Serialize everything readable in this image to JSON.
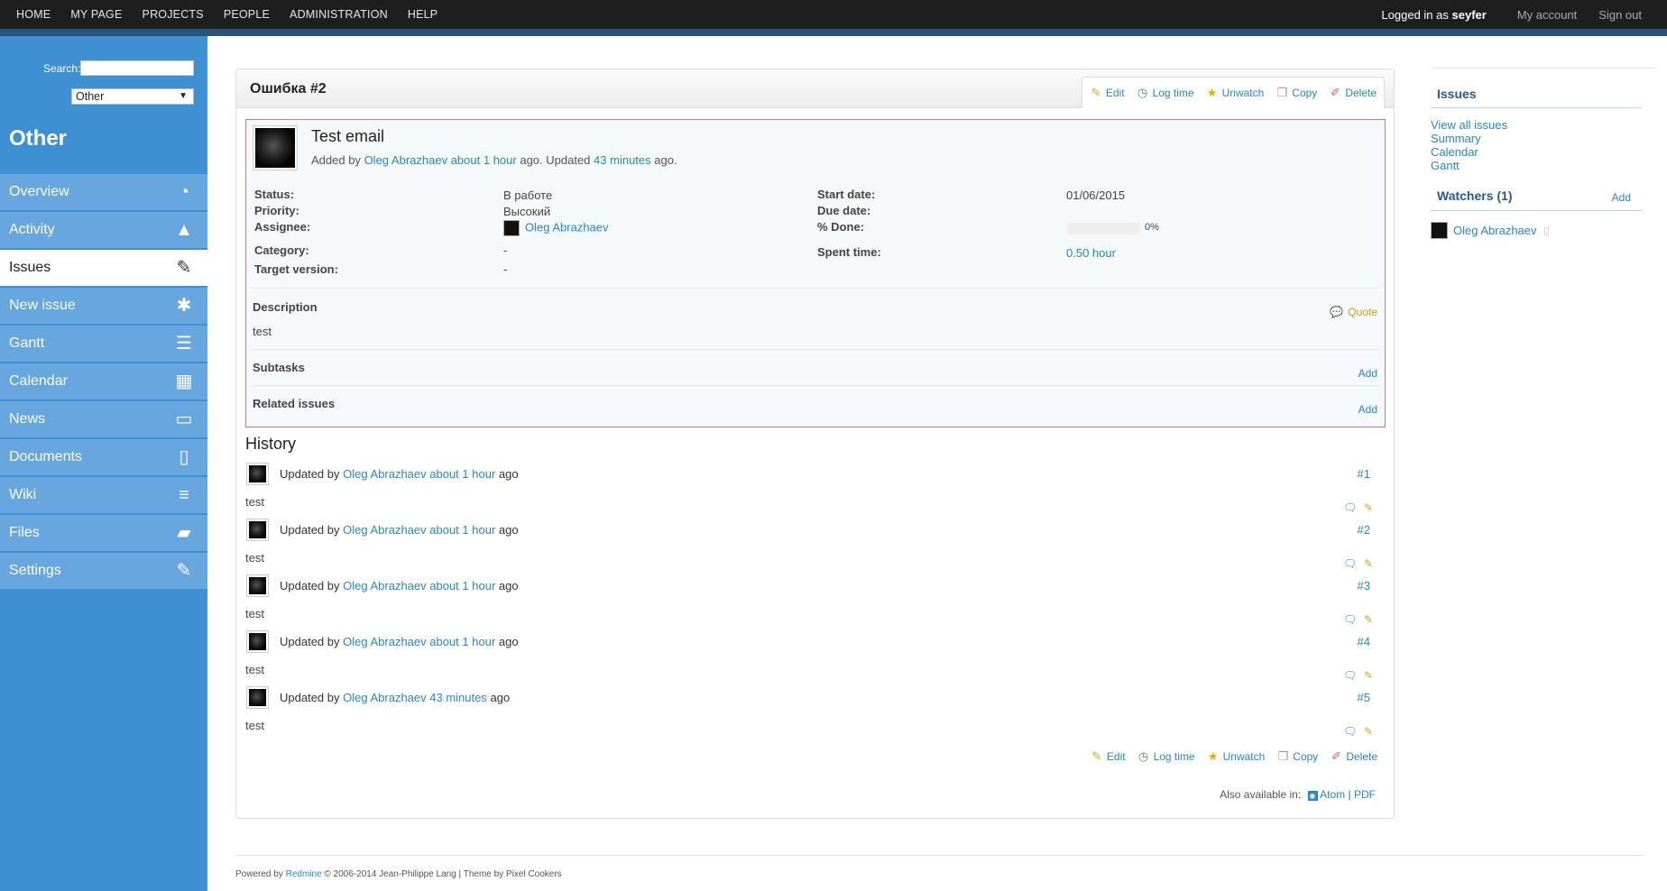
{
  "topnav": {
    "items": [
      "HOME",
      "MY PAGE",
      "PROJECTS",
      "PEOPLE",
      "ADMINISTRATION",
      "HELP"
    ],
    "logged_in_prefix": "Logged in as",
    "username": "seyfer",
    "my_account": "My account",
    "sign_out": "Sign out"
  },
  "sidebar_left": {
    "search_label": "Search:",
    "search_value": "",
    "project_select_value": "Other",
    "project_title": "Other",
    "menu": [
      {
        "label": "Overview",
        "icon": "dashboard-icon",
        "glyph": "◔"
      },
      {
        "label": "Activity",
        "icon": "road-icon",
        "glyph": "▲"
      },
      {
        "label": "Issues",
        "icon": "ticket-icon",
        "glyph": "✎",
        "selected": true
      },
      {
        "label": "New issue",
        "icon": "bug-icon",
        "glyph": "✱"
      },
      {
        "label": "Gantt",
        "icon": "gantt-icon",
        "glyph": "☰"
      },
      {
        "label": "Calendar",
        "icon": "calendar-icon",
        "glyph": "▦"
      },
      {
        "label": "News",
        "icon": "book-icon",
        "glyph": "▭"
      },
      {
        "label": "Documents",
        "icon": "document-icon",
        "glyph": "▯"
      },
      {
        "label": "Wiki",
        "icon": "align-left-icon",
        "glyph": "≡"
      },
      {
        "label": "Files",
        "icon": "folder-open-icon",
        "glyph": "▰"
      },
      {
        "label": "Settings",
        "icon": "wrench-icon",
        "glyph": "✎"
      }
    ]
  },
  "issue": {
    "heading": "Ошибка #2",
    "subject": "Test email",
    "added_by_prefix": "Added by",
    "author": "Oleg Abrazhaev",
    "added_ago": "about 1 hour",
    "updated_text": "ago. Updated",
    "updated_ago": "43 minutes",
    "ago_suffix": "ago.",
    "attributes": {
      "status_label": "Status:",
      "status_value": "В работе",
      "priority_label": "Priority:",
      "priority_value": "Высокий",
      "assignee_label": "Assignee:",
      "assignee_value": "Oleg Abrazhaev",
      "category_label": "Category:",
      "category_value": "-",
      "target_label": "Target version:",
      "target_value": "-",
      "start_label": "Start date:",
      "start_value": "01/06/2015",
      "due_label": "Due date:",
      "due_value": "",
      "done_label": "% Done:",
      "done_value": "0%",
      "done_fraction": 0,
      "spent_label": "Spent time:",
      "spent_value": "0.50 hour"
    },
    "description_title": "Description",
    "quote_label": "Quote",
    "description_text": "test",
    "subtasks_title": "Subtasks",
    "subtasks_add": "Add",
    "related_title": "Related issues",
    "related_add": "Add"
  },
  "actions": {
    "edit": "Edit",
    "log_time": "Log time",
    "unwatch": "Unwatch",
    "copy": "Copy",
    "delete": "Delete"
  },
  "history": {
    "title": "History",
    "updated_by": "Updated by",
    "ago": "ago",
    "journals": [
      {
        "author": "Oleg Abrazhaev",
        "when": "about 1 hour",
        "num": "#1",
        "note": "test"
      },
      {
        "author": "Oleg Abrazhaev",
        "when": "about 1 hour",
        "num": "#2",
        "note": "test"
      },
      {
        "author": "Oleg Abrazhaev",
        "when": "about 1 hour",
        "num": "#3",
        "note": "test"
      },
      {
        "author": "Oleg Abrazhaev",
        "when": "about 1 hour",
        "num": "#4",
        "note": "test"
      },
      {
        "author": "Oleg Abrazhaev",
        "when": "43 minutes",
        "num": "#5",
        "note": "test"
      }
    ]
  },
  "other_formats": {
    "label": "Also available in:",
    "atom": "Atom",
    "separator": "|",
    "pdf": "PDF"
  },
  "sidebar_right": {
    "issues_title": "Issues",
    "links": [
      "View all issues",
      "Summary",
      "Calendar",
      "Gantt"
    ],
    "watchers_title": "Watchers (1)",
    "watchers_add": "Add",
    "watcher": "Oleg Abrazhaev"
  },
  "footer": {
    "powered_by": "Powered by",
    "redmine": "Redmine",
    "copyright": "© 2006-2014 Jean-Philippe Lang | Theme by Pixel Cookers"
  },
  "colors": {
    "topbar": "#1e1e1e",
    "sidebar": "#3f8fd3",
    "menu_item": "#67a6df",
    "link": "#2a86c7",
    "issue_border": "#d17a85"
  }
}
